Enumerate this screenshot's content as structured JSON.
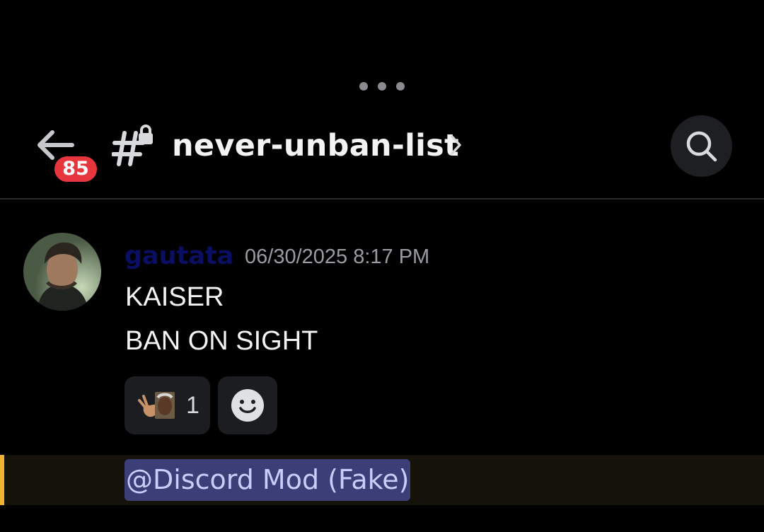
{
  "header": {
    "back_badge_count": "85",
    "channel_name": "never-unban-list",
    "icons": {
      "back": "arrow-left-icon",
      "channel": "locked-hash-channel-icon",
      "chevron": "chevron-right-icon",
      "search": "search-icon"
    }
  },
  "message": {
    "author": "gautata",
    "timestamp": "06/30/2025 8:17 PM",
    "lines": [
      "KAISER",
      "BAN ON SIGHT"
    ],
    "reactions": [
      {
        "emoji": "pointing-man-emoji",
        "count": "1"
      }
    ],
    "add_reaction_icon": "smiley-add-reaction-icon"
  },
  "next_message": {
    "mention": "@Discord Mod (Fake)"
  },
  "colors": {
    "background": "#000000",
    "badge": "#e8363f",
    "username": "#0a0f64",
    "mention_bar": "#f0b232",
    "mention_chip": "#3c3e78",
    "mention_text": "#c9cdfb"
  }
}
